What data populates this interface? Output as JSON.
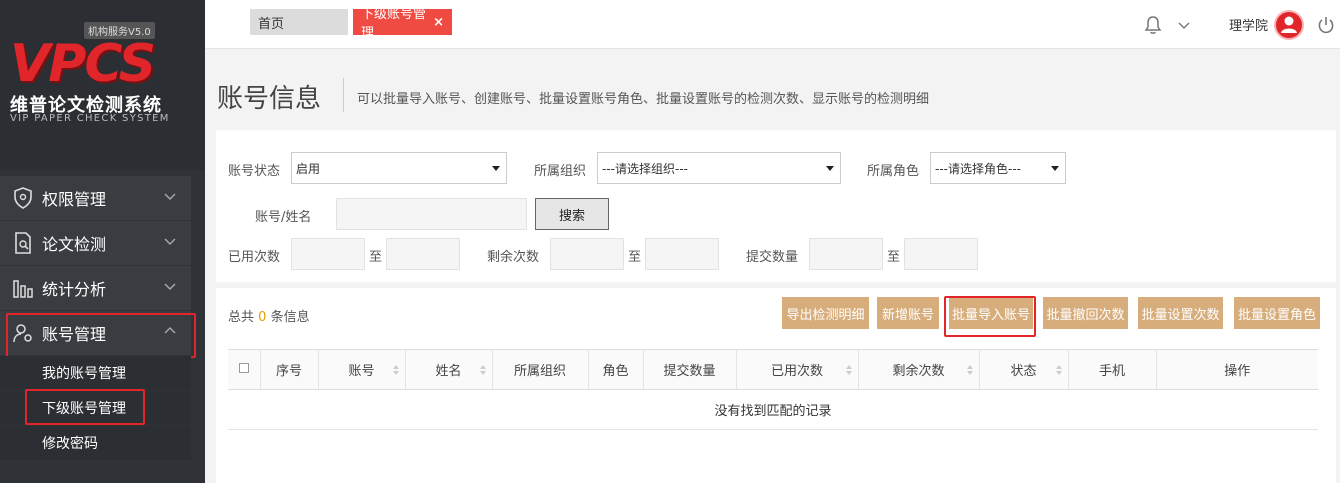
{
  "sidebar": {
    "logo": {
      "version": "机构服务V5.0",
      "brand": "VPCS",
      "title_cn": "维普论文检测系统",
      "title_en": "VIP PAPER CHECK SYSTEM"
    },
    "items": [
      {
        "label": "权限管理",
        "icon": "shield-icon"
      },
      {
        "label": "论文检测",
        "icon": "document-search-icon"
      },
      {
        "label": "统计分析",
        "icon": "bar-chart-icon"
      },
      {
        "label": "账号管理",
        "icon": "user-settings-icon"
      }
    ],
    "subitems": [
      {
        "label": "我的账号管理"
      },
      {
        "label": "下级账号管理"
      },
      {
        "label": "修改密码"
      }
    ]
  },
  "topbar": {
    "tabs": [
      {
        "label": "首页"
      },
      {
        "label": "下级账号管理",
        "close": "×"
      }
    ],
    "username": "理学院"
  },
  "header": {
    "title": "账号信息",
    "description": "可以批量导入账号、创建账号、批量设置账号角色、批量设置账号的检测次数、显示账号的检测明细"
  },
  "filters": {
    "status_label": "账号状态",
    "status_value": "启用",
    "org_label": "所属组织",
    "org_value": "---请选择组织---",
    "role_label": "所属角色",
    "role_value": "---请选择角色---",
    "name_label": "账号/姓名",
    "search_button": "搜索",
    "used_label": "已用次数",
    "remaining_label": "剩余次数",
    "submitted_label": "提交数量",
    "to": "至"
  },
  "table": {
    "total_prefix": "总共",
    "total_count": "0",
    "total_suffix": "条信息",
    "actions": [
      "导出检测明细",
      "新增账号",
      "批量导入账号",
      "批量撤回次数",
      "批量设置次数",
      "批量设置角色"
    ],
    "columns": [
      "序号",
      "账号",
      "姓名",
      "所属组织",
      "角色",
      "提交数量",
      "已用次数",
      "剩余次数",
      "状态",
      "手机",
      "操作"
    ],
    "empty_text": "没有找到匹配的记录"
  },
  "colors": {
    "accent_red": "#e0262b",
    "tab_red": "#f04b42",
    "action_button": "#d8ad7c",
    "sidebar_bg": "#2f3337"
  }
}
